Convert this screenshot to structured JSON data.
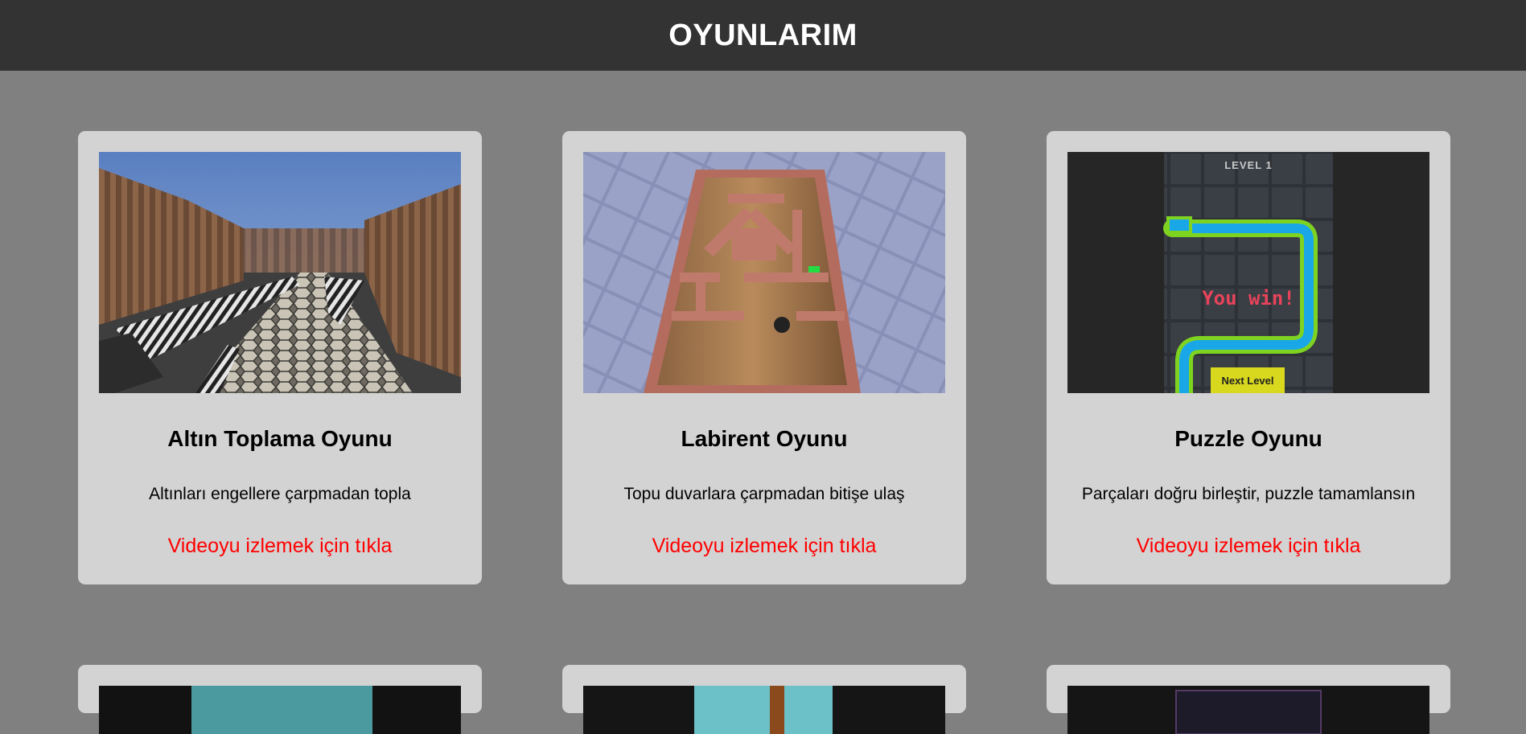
{
  "header": {
    "title": "OYUNLARIM"
  },
  "games": [
    {
      "title": "Altın Toplama Oyunu",
      "description": "Altınları engellere çarpmadan topla",
      "link_label": "Videoyu izlemek için tıkla",
      "thumbnail": "3d-runner-scene"
    },
    {
      "title": "Labirent Oyunu",
      "description": "Topu duvarlara çarpmadan bitişe ulaş",
      "link_label": "Videoyu izlemek için tıkla",
      "thumbnail": "maze-board-scene"
    },
    {
      "title": "Puzzle Oyunu",
      "description": "Parçaları doğru birleştir, puzzle tamamlansın",
      "link_label": "Videoyu izlemek için tıkla",
      "thumbnail": "pipe-puzzle-scene",
      "thumbnail_text": {
        "level": "LEVEL 1",
        "win": "You win!",
        "next_button": "Next Level"
      }
    }
  ],
  "colors": {
    "page_bg": "#808080",
    "header_bg": "#333333",
    "card_bg": "#d3d3d3",
    "link": "#ff0000"
  }
}
